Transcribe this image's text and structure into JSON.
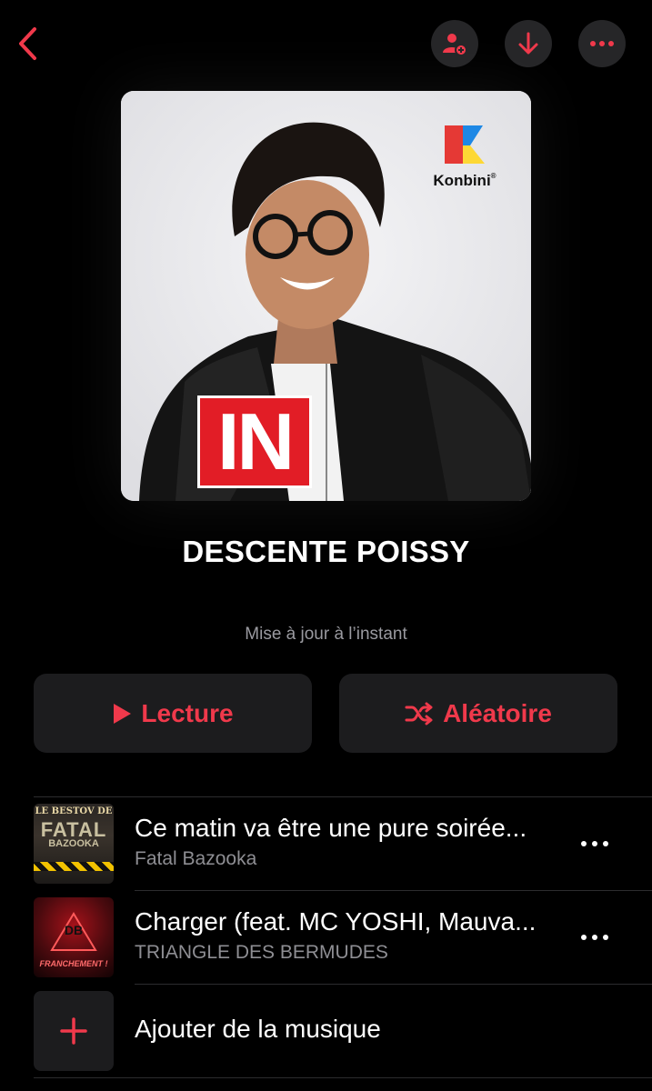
{
  "header": {
    "back_icon": "chevron-left-icon",
    "actions": [
      "add-person-icon",
      "download-icon",
      "more-icon"
    ],
    "accent": "#f0394b"
  },
  "cover": {
    "badge_text": "IN",
    "brand_label": "Konbini",
    "brand_symbol": "®"
  },
  "playlist": {
    "title": "DESCENTE POISSY",
    "updated": "Mise à jour à l’instant"
  },
  "buttons": {
    "play_label": "Lecture",
    "shuffle_label": "Aléatoire"
  },
  "tracks": [
    {
      "title": "Ce matin va être une pure soirée...",
      "artist": "Fatal Bazooka",
      "art_text": [
        "LE BESTOV DE",
        "FATAL",
        "BAZOOKA"
      ]
    },
    {
      "title": "Charger (feat. MC YOSHI, Mauva...",
      "artist": "TRIANGLE DES BERMUDES",
      "art_text": [
        "DB",
        "FRANCHEMENT !"
      ]
    }
  ],
  "add_music_label": "Ajouter de la musique"
}
